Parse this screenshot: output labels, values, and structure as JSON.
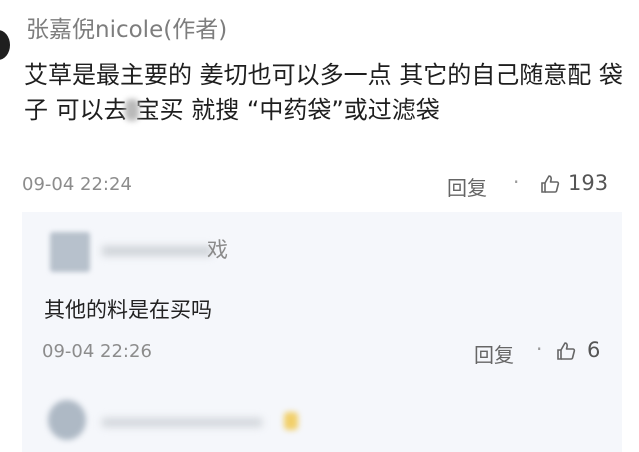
{
  "comment": {
    "author": "张嘉倪nicole(作者)",
    "text_before_blur": "艾草是最主要的 姜切也可以多一点 其它的自己随意配 袋子 可以去",
    "text_after_blur": "宝买 就搜 “中药袋”或过滤袋",
    "timestamp": "09-04 22:24",
    "reply_label": "回复",
    "separator": "·",
    "like_icon": "thumbs-up-icon",
    "like_count": "193"
  },
  "reply": {
    "author_visible_tail": "戏",
    "text": "其他的料是在买吗",
    "timestamp": "09-04 22:26",
    "reply_label": "回复",
    "separator": "·",
    "like_icon": "thumbs-up-icon",
    "like_count": "6"
  }
}
